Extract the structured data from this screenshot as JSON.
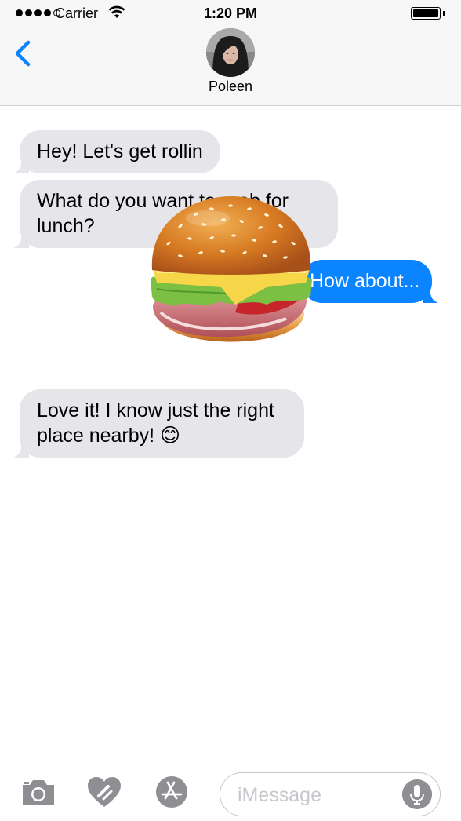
{
  "status_bar": {
    "carrier": "Carrier",
    "time": "1:20 PM"
  },
  "header": {
    "contact_name": "Poleen"
  },
  "messages": [
    {
      "direction": "incoming",
      "text": "Hey! Let's get rollin"
    },
    {
      "direction": "incoming",
      "text": "What do you want to grab for lunch?"
    },
    {
      "direction": "outgoing",
      "text": "How about..."
    },
    {
      "direction": "incoming",
      "text": "Love it! I know just the right place nearby! 😊"
    }
  ],
  "sticker": {
    "icon": "burger-sticker"
  },
  "input_bar": {
    "placeholder": "iMessage",
    "value": ""
  },
  "colors": {
    "accent": "#0b84ff",
    "incoming_bubble": "#e5e5ea",
    "outgoing_bubble": "#0b84ff",
    "toolbar_icon": "#8e8e93"
  }
}
